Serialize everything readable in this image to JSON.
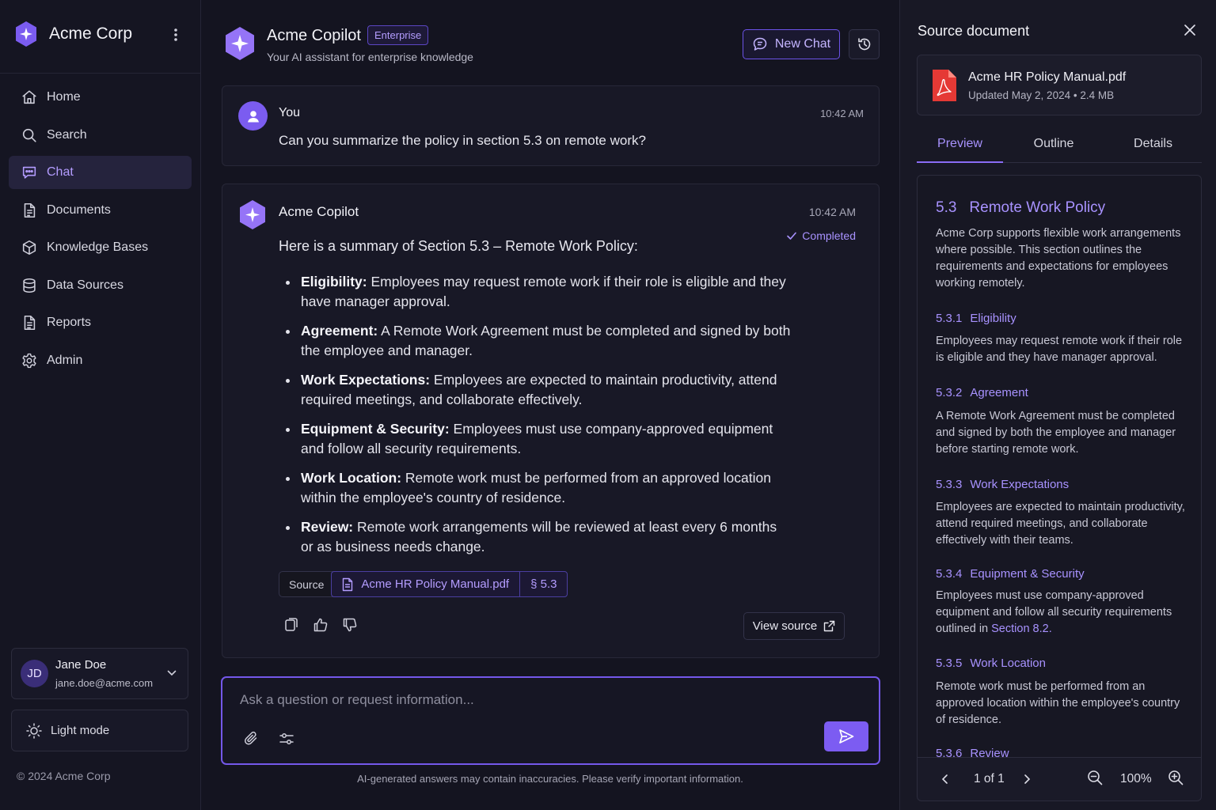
{
  "brand": {
    "name": "Acme Corp"
  },
  "nav": {
    "items": [
      {
        "label": "Home",
        "icon": "home-icon"
      },
      {
        "label": "Search",
        "icon": "search-icon"
      },
      {
        "label": "Chat",
        "icon": "chat-icon",
        "active": true
      },
      {
        "label": "Documents",
        "icon": "document-icon"
      },
      {
        "label": "Knowledge Bases",
        "icon": "cube-icon"
      },
      {
        "label": "Data Sources",
        "icon": "database-icon"
      },
      {
        "label": "Reports",
        "icon": "report-icon"
      },
      {
        "label": "Admin",
        "icon": "gear-icon"
      }
    ]
  },
  "user": {
    "initials": "JD",
    "name": "Jane Doe",
    "email": "jane.doe@acme.com"
  },
  "theme_toggle": {
    "label": "Light mode"
  },
  "footer": {
    "copyright": "© 2024 Acme Corp"
  },
  "header": {
    "title": "Acme Copilot",
    "badge": "Enterprise",
    "subtitle": "Your AI assistant for enterprise knowledge",
    "new_chat_label": "New Chat"
  },
  "messages": {
    "user": {
      "sender": "You",
      "time": "10:42 AM",
      "text": "Can you summarize the policy in section 5.3 on remote work?"
    },
    "bot": {
      "sender": "Acme Copilot",
      "time": "10:42 AM",
      "status": "Completed",
      "intro": "Here is a summary of Section 5.3 – Remote Work Policy:",
      "bullets": [
        {
          "title": "Eligibility:",
          "text": "Employees may request remote work if their role is eligible and they have manager approval."
        },
        {
          "title": "Agreement:",
          "text": "A Remote Work Agreement must be completed and signed by both the employee and manager."
        },
        {
          "title": "Work Expectations:",
          "text": "Employees are expected to maintain productivity, attend required meetings, and collaborate effectively."
        },
        {
          "title": "Equipment & Security:",
          "text": "Employees must use company-approved equipment and follow all security requirements."
        },
        {
          "title": "Work Location:",
          "text": "Remote work must be performed from an approved location within the employee's country of residence."
        },
        {
          "title": "Review:",
          "text": "Remote work arrangements will be reviewed at least every 6 months or as business needs change."
        }
      ],
      "source_label": "Source",
      "source_file": "Acme HR Policy Manual.pdf",
      "source_section": "§ 5.3",
      "view_source_label": "View source"
    }
  },
  "composer": {
    "placeholder": "Ask a question or request information...",
    "disclaimer": "AI-generated answers may contain inaccuracies. Please verify important information."
  },
  "panel": {
    "title": "Source document",
    "file_name": "Acme HR Policy Manual.pdf",
    "file_meta": "Updated May 2, 2024  •  2.4 MB",
    "tabs": [
      "Preview",
      "Outline",
      "Details"
    ],
    "active_tab": "Preview",
    "preview": {
      "heading_num": "5.3",
      "heading": "Remote Work Policy",
      "intro": "Acme Corp supports flexible work arrangements where possible. This section outlines the requirements and expectations for employees working remotely.",
      "sections": [
        {
          "num": "5.3.1",
          "title": "Eligibility",
          "text": "Employees may request remote work if their role is eligible and they have manager approval."
        },
        {
          "num": "5.3.2",
          "title": "Agreement",
          "text": "A Remote Work Agreement must be completed and signed by both the employee and manager before starting remote work."
        },
        {
          "num": "5.3.3",
          "title": "Work Expectations",
          "text": "Employees are expected to maintain productivity, attend required meetings, and collaborate effectively with their teams."
        },
        {
          "num": "5.3.4",
          "title": "Equipment & Security",
          "text": "Employees must use company-approved equipment and follow all security requirements outlined in",
          "link": "Section 8.2."
        },
        {
          "num": "5.3.5",
          "title": "Work Location",
          "text": "Remote work must be performed from an approved location within the employee's country of residence."
        },
        {
          "num": "5.3.6",
          "title": "Review",
          "text": ""
        }
      ]
    },
    "pager": {
      "page_text": "1 of 1",
      "zoom": "100%"
    }
  },
  "colors": {
    "accent": "#7c5cf2",
    "accent_text": "#a892ff",
    "background": "#141420",
    "pdf_red": "#e53935"
  }
}
